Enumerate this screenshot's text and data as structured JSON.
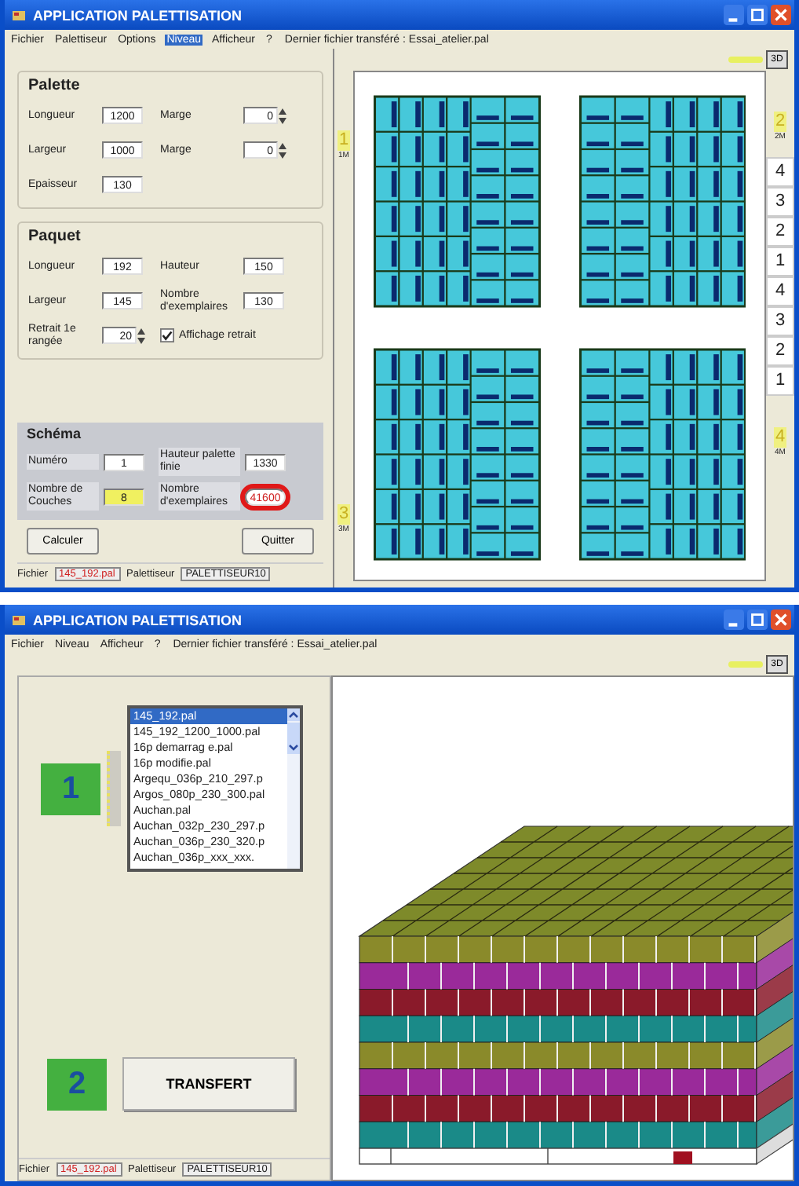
{
  "layout_window": {
    "title": "APPLICATION PALETTISATION",
    "menu": [
      {
        "label": "Fichier",
        "selected": false
      },
      {
        "label": "Palettiseur",
        "selected": false
      },
      {
        "label": "Options",
        "selected": false
      },
      {
        "label": "Niveau",
        "selected": true
      },
      {
        "label": "Afficheur",
        "selected": false
      },
      {
        "label": "?",
        "selected": false
      }
    ],
    "last_file": "Dernier fichier transféré : Essai_atelier.pal",
    "view_button": "3D",
    "groups": [
      {
        "title": "Palette",
        "rows": [
          [
            {
              "kind": "field",
              "label": "Longueur",
              "value": "1200"
            },
            {
              "kind": "spin",
              "label": "Marge",
              "value": "0"
            }
          ],
          [
            {
              "kind": "field",
              "label": "Largeur",
              "value": "1000"
            },
            {
              "kind": "spin",
              "label": "Marge",
              "value": "0"
            }
          ],
          [
            {
              "kind": "field",
              "label": "Epaisseur",
              "value": "130"
            }
          ]
        ]
      },
      {
        "title": "Paquet",
        "rows": [
          [
            {
              "kind": "field",
              "label": "Longueur",
              "value": "192"
            },
            {
              "kind": "field",
              "label": "Hauteur",
              "value": "150"
            }
          ],
          [
            {
              "kind": "field",
              "label": "Largeur",
              "value": "145"
            },
            {
              "kind": "field",
              "label": "Nombre d'exemplaires",
              "value": "130"
            }
          ],
          [
            {
              "kind": "spin",
              "label": "Retrait 1e rangée",
              "value": "20"
            },
            {
              "kind": "checkbox",
              "label": "Affichage retrait",
              "checked": true
            }
          ]
        ]
      }
    ],
    "schema": {
      "title": "Schéma",
      "rows": [
        [
          {
            "label": "Numéro",
            "value": "1",
            "highlight": false,
            "circled": false
          },
          {
            "label": "Hauteur palette finie",
            "value": "1330",
            "highlight": false,
            "circled": false
          }
        ],
        [
          {
            "label": "Nombre de Couches",
            "value": "8",
            "highlight": true,
            "circled": false
          },
          {
            "label": "Nombre d'exemplaires",
            "value": "41600",
            "highlight": false,
            "circled": true
          }
        ]
      ]
    },
    "buttons": [
      "Calculer",
      "Quitter"
    ],
    "quadrants": [
      {
        "number": "1",
        "size": "1M"
      },
      {
        "number": "2",
        "size": "2M"
      },
      {
        "number": "3",
        "size": "3M"
      },
      {
        "number": "4",
        "size": "4M"
      }
    ],
    "layer_numbers": [
      "4",
      "3",
      "2",
      "1",
      "4",
      "3",
      "2",
      "1"
    ],
    "status": {
      "file_label": "Fichier",
      "file": "145_192.pal",
      "palettiser_label": "Palettiseur",
      "palettiser": "PALETTISEUR10"
    }
  },
  "transfer_window": {
    "title": "APPLICATION PALETTISATION",
    "menu": [
      {
        "label": "Fichier",
        "selected": false
      },
      {
        "label": "Niveau",
        "selected": false
      },
      {
        "label": "Afficheur",
        "selected": false
      },
      {
        "label": "?",
        "selected": false
      }
    ],
    "last_file": "Dernier fichier transféré : Essai_atelier.pal",
    "view_button": "3D",
    "step_1": "1",
    "step_2": "2",
    "files": [
      {
        "name": "145_192.pal",
        "selected": true
      },
      {
        "name": "145_192_1200_1000.pal",
        "selected": false
      },
      {
        "name": "16p demarrag e.pal",
        "selected": false
      },
      {
        "name": "16p modifie.pal",
        "selected": false
      },
      {
        "name": "Argequ_036p_210_297.p",
        "selected": false
      },
      {
        "name": "Argos_080p_230_300.pal",
        "selected": false
      },
      {
        "name": "Auchan.pal",
        "selected": false
      },
      {
        "name": "Auchan_032p_230_297.p",
        "selected": false
      },
      {
        "name": "Auchan_036p_230_320.p",
        "selected": false
      },
      {
        "name": "Auchan_036p_xxx_xxx.",
        "selected": false
      }
    ],
    "transfer_button": "TRANSFERT",
    "status": {
      "file_label": "Fichier",
      "file": "145_192.pal",
      "palettiser_label": "Palettiseur",
      "palettiser": "PALETTISEUR10"
    }
  }
}
